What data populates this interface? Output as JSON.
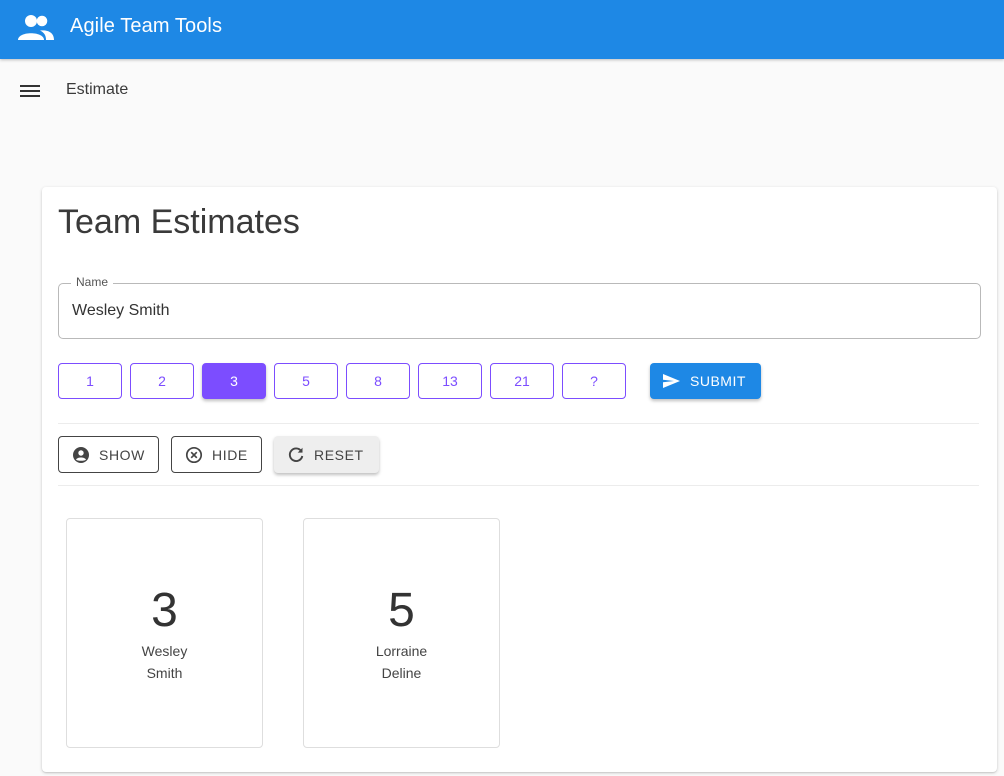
{
  "app": {
    "title": "Agile Team Tools",
    "logo_icon": "group-icon",
    "brand_color": "#1e88e5"
  },
  "toolbar": {
    "menu_icon": "menu-icon",
    "page_label": "Estimate"
  },
  "main": {
    "heading": "Team Estimates",
    "name_field": {
      "label": "Name",
      "value": "Wesley Smith"
    },
    "estimate_options": [
      {
        "label": "1",
        "selected": false
      },
      {
        "label": "2",
        "selected": false
      },
      {
        "label": "3",
        "selected": true
      },
      {
        "label": "5",
        "selected": false
      },
      {
        "label": "8",
        "selected": false
      },
      {
        "label": "13",
        "selected": false
      },
      {
        "label": "21",
        "selected": false
      },
      {
        "label": "?",
        "selected": false
      }
    ],
    "submit_label": "SUBMIT",
    "actions": {
      "show_label": "SHOW",
      "hide_label": "HIDE",
      "reset_label": "RESET"
    },
    "results": [
      {
        "value": "3",
        "first_name": "Wesley",
        "last_name": "Smith"
      },
      {
        "value": "5",
        "first_name": "Lorraine",
        "last_name": "Deline"
      }
    ],
    "accent_color": "#7c4dff"
  }
}
